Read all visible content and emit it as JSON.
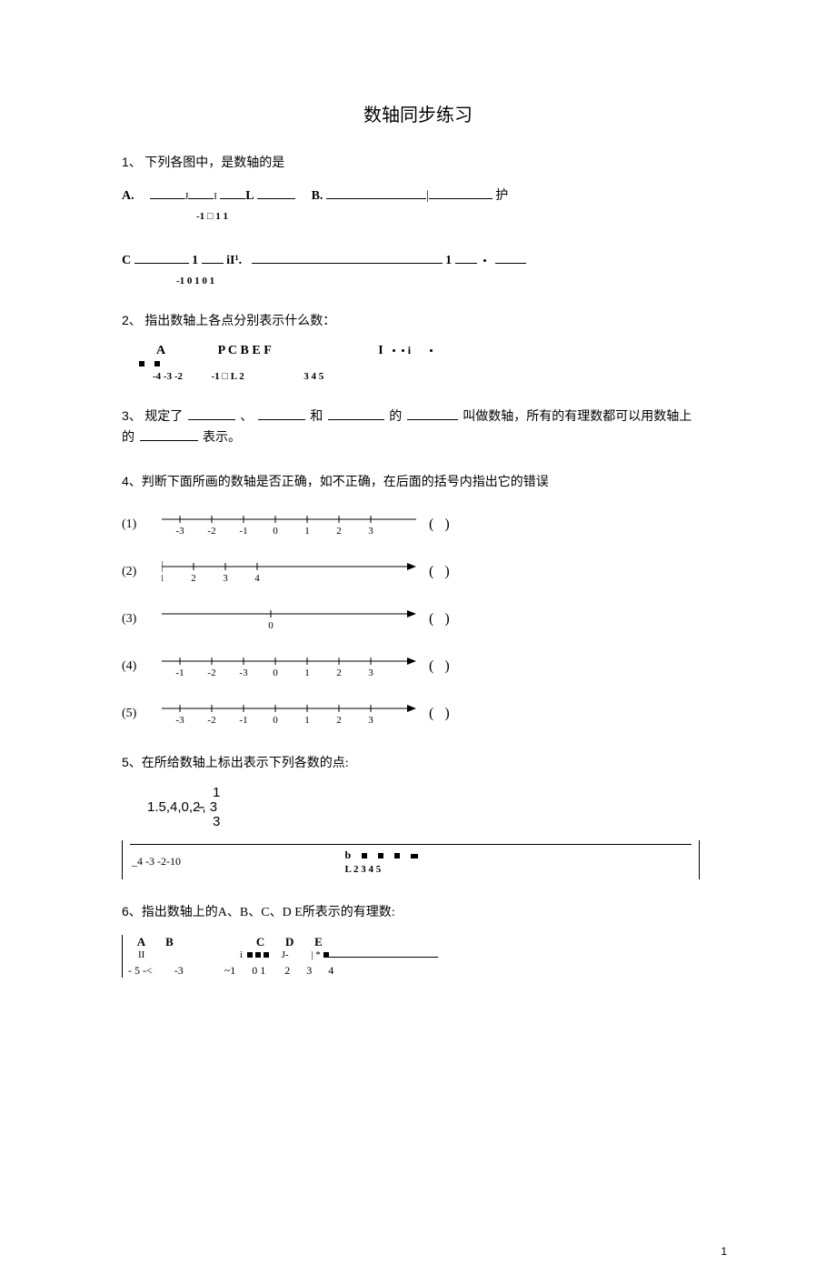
{
  "title": "数轴同步练习",
  "q1": {
    "prompt": "下列各图中，是数轴的是",
    "optA": "A.",
    "optA_ticks": "-1 □ 1 1",
    "optA_tail": "J",
    "optA_L": "L",
    "optB": "B.",
    "optB_tail": "护",
    "optC": "C",
    "optC_mid": "1",
    "optC_il": "iI¹.",
    "optC_right": "1",
    "optC_ticks": "-1 0 1 0 1"
  },
  "q2": {
    "prompt": "指出数轴上各点分别表示什么数：",
    "letters_left": "A",
    "letters_mid": "P C B E F",
    "letters_right": "I",
    "ticks_left": "-4    -3 -2",
    "ticks_mid": "-1      □ L 2",
    "ticks_right": "3    4    5",
    "I": "I",
    "i": "i"
  },
  "q3": {
    "text1": "规定了",
    "text2": "、",
    "text3": "和",
    "text4": "的",
    "text5": "叫做数轴，所有的有理数都可以用数轴上",
    "text6": "的",
    "text7": "表示。"
  },
  "q4": {
    "prompt": "判断下面所画的数轴是否正确，如不正确，在后面的括号内指出它的错误",
    "items": [
      {
        "label": "(1)",
        "ticks": [
          "-3",
          "-2",
          "-1",
          "0",
          "1",
          "2",
          "3"
        ],
        "arrow": false,
        "tick_origin": 20
      },
      {
        "label": "(2)",
        "ticks": [
          "1",
          "2",
          "3",
          "4"
        ],
        "arrow": true,
        "tick_origin": 0,
        "front_bar": true
      },
      {
        "label": "(3)",
        "ticks": [
          "0"
        ],
        "arrow": true,
        "tick_origin": 120,
        "single": true
      },
      {
        "label": "(4)",
        "ticks": [
          "-1",
          "-2",
          "-3",
          "0",
          "1",
          "2",
          "3"
        ],
        "arrow": true,
        "tick_origin": 20
      },
      {
        "label": "(5)",
        "ticks": [
          "-3",
          "-2",
          "-1",
          "0",
          "1",
          "2",
          "3"
        ],
        "arrow": true,
        "tick_origin": 20
      }
    ]
  },
  "q5": {
    "prompt": "在所给数轴上标出表示下列各数的点:",
    "frac_top": "1",
    "nums_line": "1.5,4,0,2-",
    "nums_after": "-, 3",
    "frac_bot": "3",
    "left_ticks": "_4    -3    -2-10",
    "right_b": "b",
    "right_L": "L    2    3    4    5"
  },
  "q6": {
    "prompt": "指出数轴上的A、B、C、D E所表示的有理数:",
    "letters": "A       B                            C       D       E",
    "marks": "II                                      i",
    "marks_r": "J-         | *",
    "ticks": "- 5 -<        -3               ~1      0 1       2      3      4"
  },
  "page_num": "1"
}
